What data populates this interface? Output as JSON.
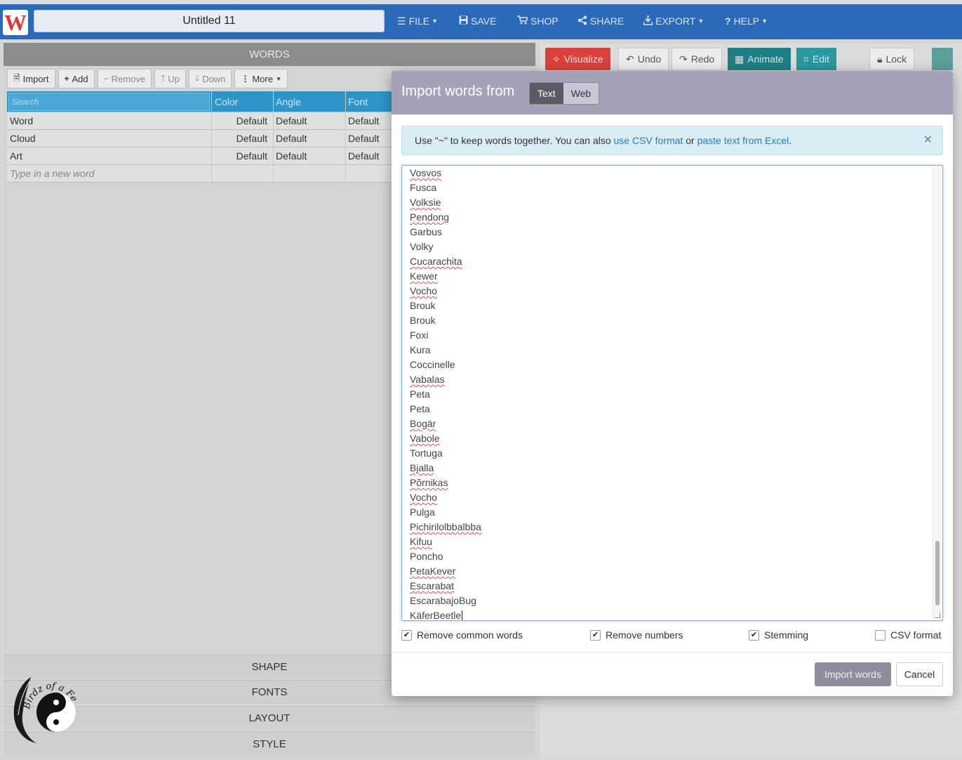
{
  "topbar": {
    "logo_letter": "W",
    "document_title": "Untitled 11",
    "menu": [
      {
        "label": "FILE",
        "icon": "hamburger-icon",
        "dropdown": true
      },
      {
        "label": "SAVE",
        "icon": "floppy-icon",
        "dropdown": false
      },
      {
        "label": "SHOP",
        "icon": "cart-icon",
        "dropdown": false
      },
      {
        "label": "SHARE",
        "icon": "share-icon",
        "dropdown": false
      },
      {
        "label": "EXPORT",
        "icon": "download-icon",
        "dropdown": true
      },
      {
        "label": "HELP",
        "icon": "question-icon",
        "dropdown": true
      }
    ]
  },
  "words_panel": {
    "header": "WORDS",
    "toolbar": {
      "import": "Import",
      "add": "Add",
      "remove": "Remove",
      "up": "Up",
      "down": "Down",
      "more": "More"
    },
    "table": {
      "search_placeholder": "Search",
      "columns": [
        "Color",
        "Angle",
        "Font"
      ],
      "rows": [
        {
          "word": "Word",
          "color": "Default",
          "angle": "Default",
          "font": "Default"
        },
        {
          "word": "Cloud",
          "color": "Default",
          "angle": "Default",
          "font": "Default"
        },
        {
          "word": "Art",
          "color": "Default",
          "angle": "Default",
          "font": "Default"
        }
      ],
      "new_word_placeholder": "Type in a new word"
    },
    "sections": [
      "SHAPE",
      "FONTS",
      "LAYOUT",
      "STYLE"
    ]
  },
  "right_toolbar": {
    "visualize": "Visualize",
    "undo": "Undo",
    "redo": "Redo",
    "animate": "Animate",
    "edit": "Edit",
    "lock": "Lock"
  },
  "modal": {
    "title": "Import words from",
    "source_tabs": [
      {
        "label": "Text",
        "active": true
      },
      {
        "label": "Web",
        "active": false
      }
    ],
    "info": {
      "text_before": "Use \"~\" to keep words together. You can also ",
      "link1": "use CSV format",
      "text_middle": " or ",
      "link2": "paste text from Excel",
      "text_after": "."
    },
    "words": [
      {
        "text": "Vosvos",
        "spell": true
      },
      {
        "text": "Fusca",
        "spell": false
      },
      {
        "text": "Volksie",
        "spell": true
      },
      {
        "text": "Pendong",
        "spell": true
      },
      {
        "text": "Garbus",
        "spell": false
      },
      {
        "text": "Volky",
        "spell": false
      },
      {
        "text": "Cucarachita",
        "spell": true
      },
      {
        "text": "Kewer",
        "spell": true
      },
      {
        "text": "Vocho",
        "spell": true
      },
      {
        "text": "Brouk",
        "spell": false
      },
      {
        "text": "Brouk",
        "spell": false
      },
      {
        "text": "Foxi",
        "spell": false
      },
      {
        "text": "Kura",
        "spell": false
      },
      {
        "text": "Coccinelle",
        "spell": false
      },
      {
        "text": "Vabalas",
        "spell": true
      },
      {
        "text": "Peta",
        "spell": false
      },
      {
        "text": "Peta",
        "spell": false
      },
      {
        "text": "Bogär",
        "spell": true
      },
      {
        "text": "Vabole",
        "spell": true
      },
      {
        "text": "Tortuga",
        "spell": false
      },
      {
        "text": "Bjalla",
        "spell": true
      },
      {
        "text": "Põrnikas",
        "spell": true
      },
      {
        "text": "Vocho",
        "spell": true
      },
      {
        "text": "Pulga",
        "spell": false
      },
      {
        "text": "Pichirilolbbalbba",
        "spell": true
      },
      {
        "text": "Kifuu",
        "spell": true
      },
      {
        "text": "Poncho",
        "spell": false
      },
      {
        "text": "PetaKever",
        "spell": true
      },
      {
        "text": "Escarabat",
        "spell": true
      },
      {
        "text": "EscarabajoBug",
        "spell": false
      },
      {
        "text": "KäferBeetle",
        "spell": true
      }
    ],
    "options": [
      {
        "label": "Remove common words",
        "checked": true
      },
      {
        "label": "Remove numbers",
        "checked": true
      },
      {
        "label": "Stemming",
        "checked": true
      },
      {
        "label": "CSV format",
        "checked": false
      }
    ],
    "import_button": "Import words",
    "cancel_button": "Cancel"
  },
  "watermark": {
    "text": "Birdz of a Feather"
  },
  "colors": {
    "topbar": "#2a6ab8",
    "visualize": "#d9413b",
    "animate": "#1f7f86",
    "modal_header": "#a4a1b8",
    "link": "#2b7bb9"
  }
}
